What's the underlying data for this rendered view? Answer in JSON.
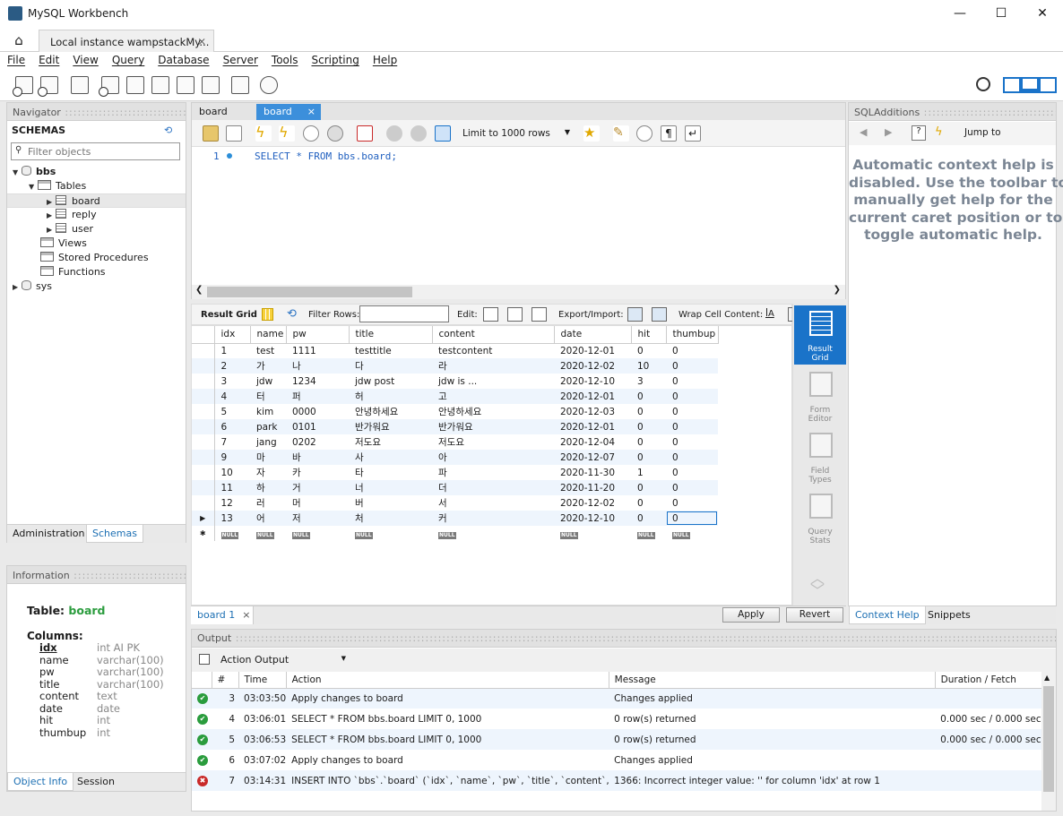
{
  "window": {
    "title": "MySQL Workbench",
    "min": "—",
    "max": "☐",
    "close": "✕"
  },
  "conn_tab": {
    "label": "Local instance wampstackMy...",
    "close": "×"
  },
  "menu": [
    "File",
    "Edit",
    "View",
    "Query",
    "Database",
    "Server",
    "Tools",
    "Scripting",
    "Help"
  ],
  "navigator": {
    "header": "Navigator",
    "schemas_label": "SCHEMAS",
    "filter_placeholder": "Filter objects",
    "tree": {
      "bbs": "bbs",
      "tables": "Tables",
      "board": "board",
      "reply": "reply",
      "user": "user",
      "views": "Views",
      "procs": "Stored Procedures",
      "funcs": "Functions",
      "sys": "sys"
    },
    "tabs": [
      "Administration",
      "Schemas"
    ]
  },
  "information": {
    "header": "Information",
    "table_label": "Table:",
    "table_name": "board",
    "columns_label": "Columns:",
    "columns": [
      {
        "name": "idx",
        "type": "int AI PK"
      },
      {
        "name": "name",
        "type": "varchar(100)"
      },
      {
        "name": "pw",
        "type": "varchar(100)"
      },
      {
        "name": "title",
        "type": "varchar(100)"
      },
      {
        "name": "content",
        "type": "text"
      },
      {
        "name": "date",
        "type": "date"
      },
      {
        "name": "hit",
        "type": "int"
      },
      {
        "name": "thumbup",
        "type": "int"
      }
    ],
    "tabs": [
      "Object Info",
      "Session"
    ]
  },
  "query_tabs": [
    "board",
    "board"
  ],
  "query_tab_close": "×",
  "editor": {
    "limit_label": "Limit to 1000 rows",
    "line_no": "1",
    "sql": "SELECT * FROM bbs.board;"
  },
  "result_toolbar": {
    "grid": "Result Grid",
    "filter": "Filter Rows:",
    "edit": "Edit:",
    "export": "Export/Import:",
    "wrap": "Wrap Cell Content:"
  },
  "grid": {
    "columns": [
      "idx",
      "name",
      "pw",
      "title",
      "content",
      "date",
      "hit",
      "thumbup"
    ],
    "rows": [
      [
        "1",
        "test",
        "1111",
        "testtitle",
        "testcontent",
        "2020-12-01",
        "0",
        "0"
      ],
      [
        "2",
        "가",
        "나",
        "다",
        "라",
        "2020-12-02",
        "10",
        "0"
      ],
      [
        "3",
        "jdw",
        "1234",
        "jdw post",
        "jdw is ...",
        "2020-12-10",
        "3",
        "0"
      ],
      [
        "4",
        "터",
        "퍼",
        "허",
        "고",
        "2020-12-01",
        "0",
        "0"
      ],
      [
        "5",
        "kim",
        "0000",
        "안녕하세요",
        "안녕하세요",
        "2020-12-03",
        "0",
        "0"
      ],
      [
        "6",
        "park",
        "0101",
        "반가워요",
        "반가워요",
        "2020-12-01",
        "0",
        "0"
      ],
      [
        "7",
        "jang",
        "0202",
        "저도요",
        "저도요",
        "2020-12-04",
        "0",
        "0"
      ],
      [
        "9",
        "마",
        "바",
        "사",
        "아",
        "2020-12-07",
        "0",
        "0"
      ],
      [
        "10",
        "자",
        "카",
        "타",
        "파",
        "2020-11-30",
        "1",
        "0"
      ],
      [
        "11",
        "하",
        "거",
        "너",
        "더",
        "2020-11-20",
        "0",
        "0"
      ],
      [
        "12",
        "러",
        "머",
        "버",
        "서",
        "2020-12-02",
        "0",
        "0"
      ],
      [
        "13",
        "어",
        "저",
        "처",
        "커",
        "2020-12-10",
        "0",
        "0"
      ]
    ],
    "null_label": "NULL"
  },
  "sidebar_buttons": [
    {
      "l1": "Result",
      "l2": "Grid"
    },
    {
      "l1": "Form",
      "l2": "Editor"
    },
    {
      "l1": "Field",
      "l2": "Types"
    },
    {
      "l1": "Query",
      "l2": "Stats"
    }
  ],
  "result_footer": {
    "tab": "board 1",
    "close": "×",
    "apply": "Apply",
    "revert": "Revert"
  },
  "sql_additions": {
    "header": "SQLAdditions",
    "jump": "Jump to",
    "help": [
      "Automatic context help is",
      "disabled. Use the toolbar to",
      "manually get help for the",
      "current caret position or to",
      "toggle automatic help."
    ],
    "tabs": [
      "Context Help",
      "Snippets"
    ]
  },
  "output": {
    "header": "Output",
    "selector": "Action Output",
    "columns": [
      "",
      "#",
      "Time",
      "Action",
      "Message",
      "Duration / Fetch"
    ],
    "rows": [
      {
        "status": "ok",
        "n": "3",
        "time": "03:03:50",
        "action": "Apply changes to board",
        "msg": "Changes applied",
        "dur": ""
      },
      {
        "status": "ok",
        "n": "4",
        "time": "03:06:01",
        "action": "SELECT * FROM bbs.board LIMIT 0, 1000",
        "msg": "0 row(s) returned",
        "dur": "0.000 sec / 0.000 sec"
      },
      {
        "status": "ok",
        "n": "5",
        "time": "03:06:53",
        "action": "SELECT * FROM bbs.board LIMIT 0, 1000",
        "msg": "0 row(s) returned",
        "dur": "0.000 sec / 0.000 sec"
      },
      {
        "status": "ok",
        "n": "6",
        "time": "03:07:02",
        "action": "Apply changes to board",
        "msg": "Changes applied",
        "dur": ""
      },
      {
        "status": "err",
        "n": "7",
        "time": "03:14:31",
        "action": "INSERT INTO `bbs`.`board` (`idx`, `name`, `pw`, `title`, `content`, `date`, `hi...",
        "msg": "1366: Incorrect integer value: '' for column 'idx' at row 1",
        "dur": ""
      }
    ]
  },
  "colors": {
    "accent": "#1a73c9",
    "tab_active": "#3c8fdb",
    "ok": "#2a9c3d",
    "error": "#c92a2a",
    "keyword": "#1f5fbf"
  }
}
